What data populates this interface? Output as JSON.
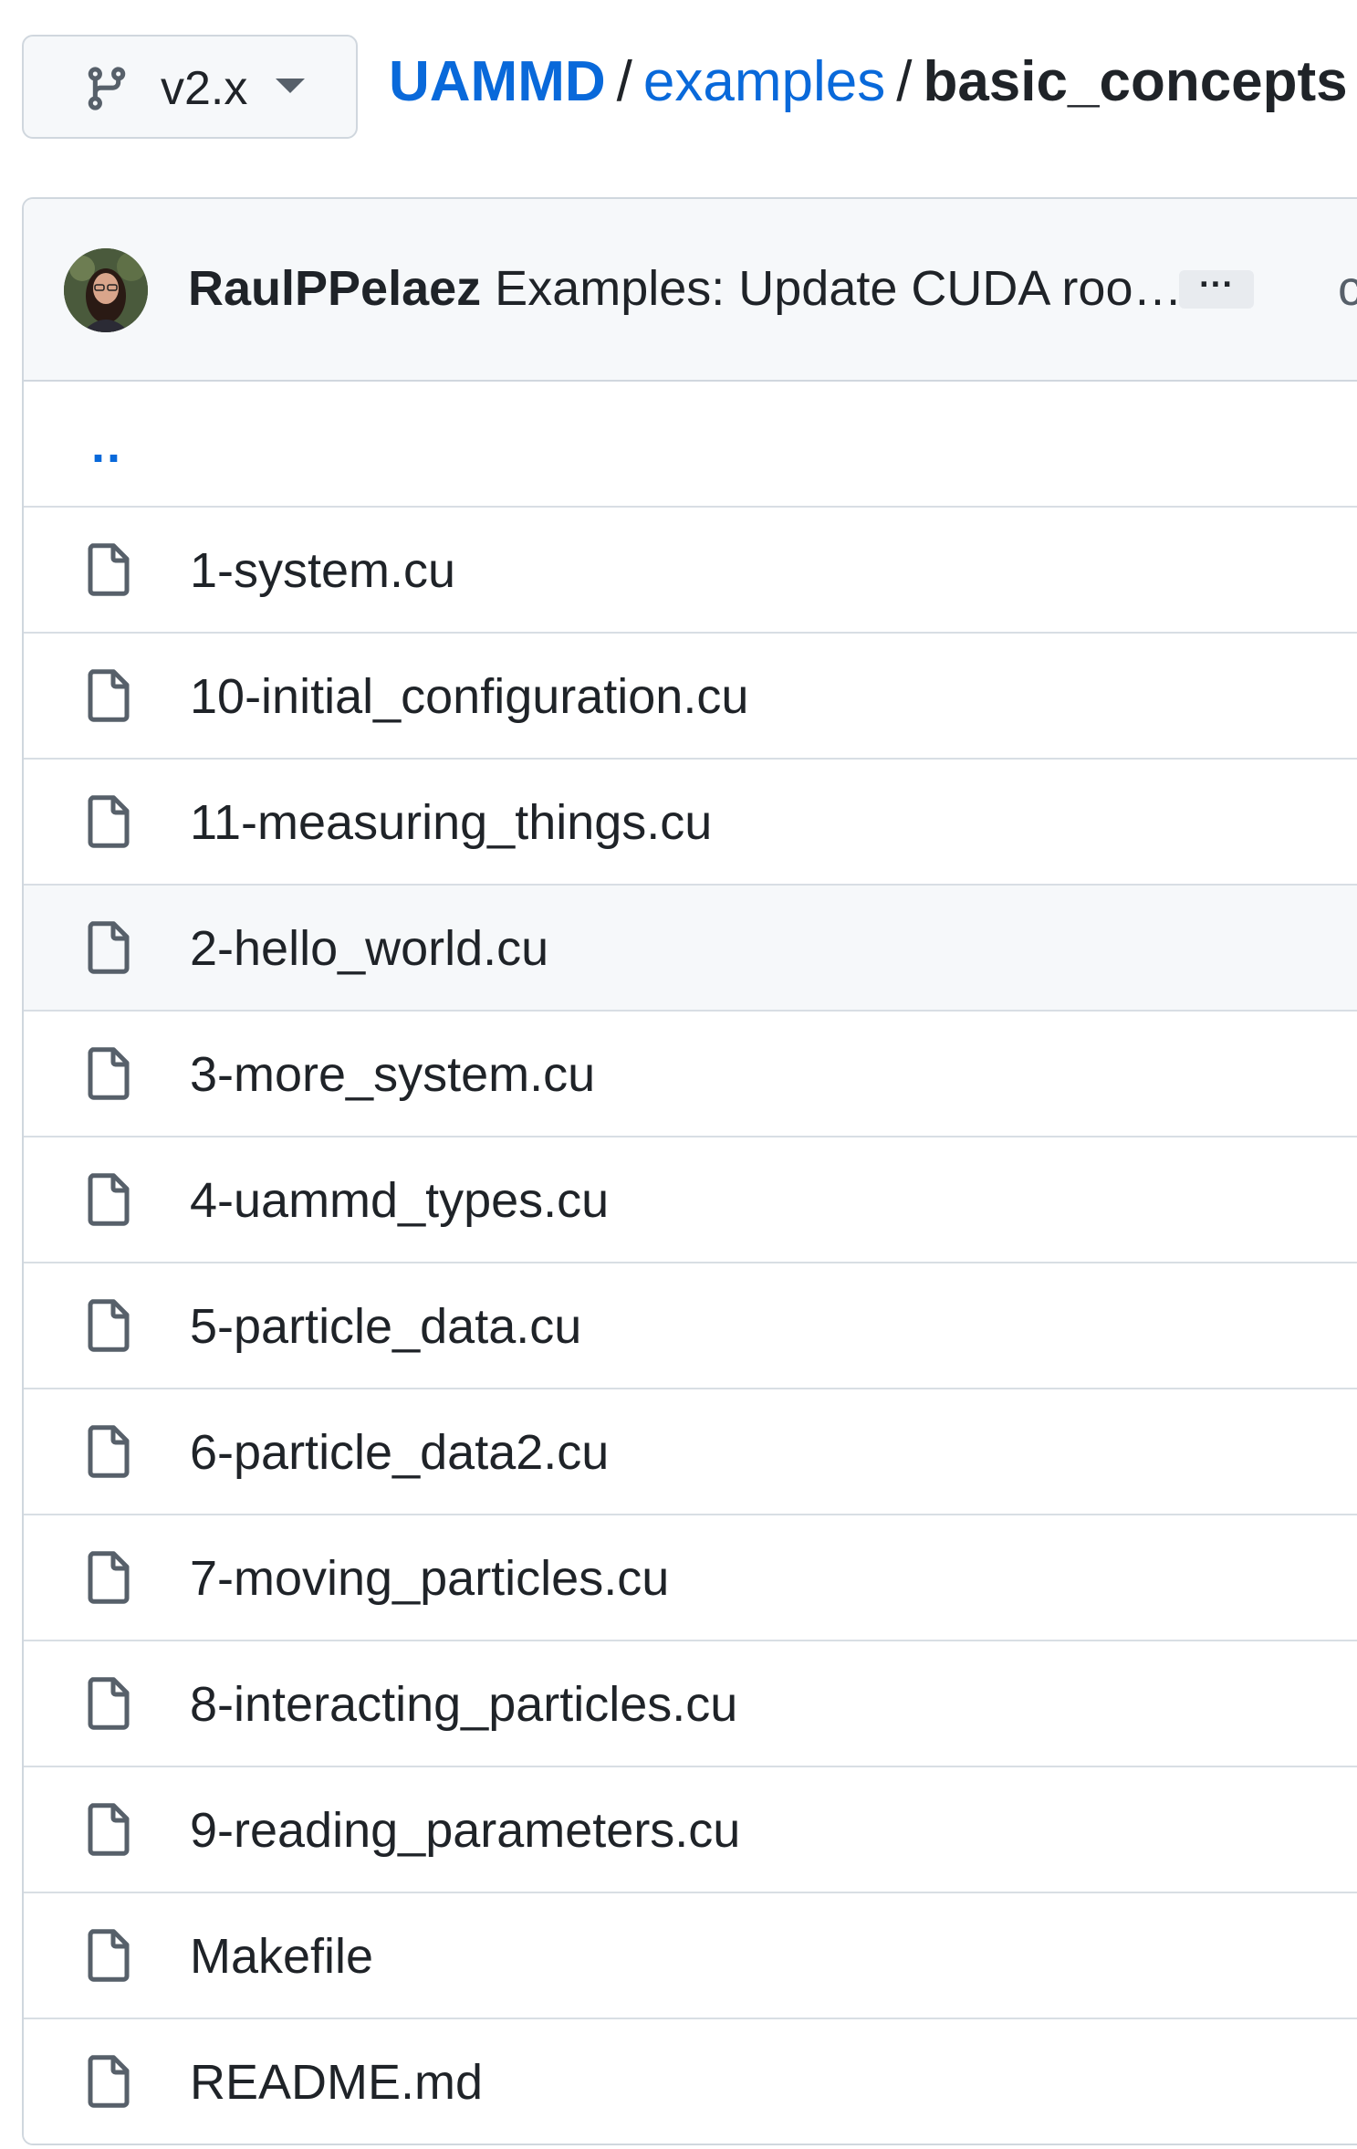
{
  "branch": {
    "label": "v2.x",
    "icon": "git-branch-icon"
  },
  "breadcrumb": {
    "repo": "UAMMD",
    "folder": "examples",
    "current": "basic_concepts",
    "separator": "/"
  },
  "commit": {
    "author": "RaulPPelaez",
    "message": "Examples: Update CUDA roo…",
    "expand_label": "···",
    "trailing_text": "c"
  },
  "parent_dir": "..",
  "files": [
    {
      "name": "1-system.cu",
      "icon": "file-icon"
    },
    {
      "name": "10-initial_configuration.cu",
      "icon": "file-icon"
    },
    {
      "name": "11-measuring_things.cu",
      "icon": "file-icon"
    },
    {
      "name": "2-hello_world.cu",
      "icon": "file-icon"
    },
    {
      "name": "3-more_system.cu",
      "icon": "file-icon"
    },
    {
      "name": "4-uammd_types.cu",
      "icon": "file-icon"
    },
    {
      "name": "5-particle_data.cu",
      "icon": "file-icon"
    },
    {
      "name": "6-particle_data2.cu",
      "icon": "file-icon"
    },
    {
      "name": "7-moving_particles.cu",
      "icon": "file-icon"
    },
    {
      "name": "8-interacting_particles.cu",
      "icon": "file-icon"
    },
    {
      "name": "9-reading_parameters.cu",
      "icon": "file-icon"
    },
    {
      "name": "Makefile",
      "icon": "file-icon"
    },
    {
      "name": "README.md",
      "icon": "file-icon"
    }
  ],
  "colors": {
    "link": "#0969da",
    "text": "#1f2328",
    "border": "#d0d7de",
    "header_bg": "#f6f8fa"
  }
}
